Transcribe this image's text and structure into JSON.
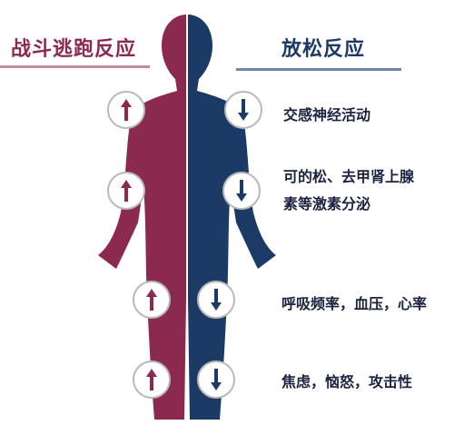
{
  "colors": {
    "fight": "#8b2a4e",
    "fight_line": "#c48aa0",
    "relax": "#1b3a66",
    "relax_line": "#6f86a8",
    "circle_border": "#b9b9b9"
  },
  "left_title": "战斗逃跑反应",
  "right_title": "放松反应",
  "labels": {
    "sympathetic": "交感神经活动",
    "hormones_line1": "可的松、去甲肾上腺",
    "hormones_line2": "素等激素分泌",
    "vitals": "呼吸频率，血压，心率",
    "emotions": "焦虑，恼怒，攻击性"
  },
  "indicators": {
    "left": "up-arrow-icon",
    "right": "down-arrow-icon"
  }
}
